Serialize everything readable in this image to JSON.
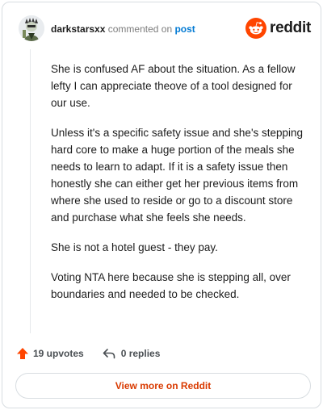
{
  "comment": {
    "author": "darkstarsxx",
    "action_text": "commented on",
    "post_link": "post",
    "paragraphs": [
      "She is confused AF about the situation. As a fellow lefty I can appreciate theove of a tool designed for our use.",
      "Unless it's a specific safety issue and she's stepping hard core to make a huge portion of the meals she needs to learn to adapt. If it is a safety issue then honestly she can either get her previous items from where she used to reside or go to a discount store and purchase what she feels she needs.",
      "She is not a hotel guest - they pay.",
      "Voting NTA here because she is stepping all, over boundaries and needed to be checked."
    ]
  },
  "brand": {
    "wordmark": "reddit",
    "logo_icon": "reddit-snoo-icon",
    "color": "#ff4500"
  },
  "stats": {
    "upvotes": "19 upvotes",
    "replies": "0 replies",
    "upvote_icon": "upvote-arrow-icon",
    "reply_icon": "reply-arrow-icon",
    "upvote_color": "#ff4500"
  },
  "footer": {
    "view_more": "View more on Reddit",
    "color": "#d93a00"
  }
}
